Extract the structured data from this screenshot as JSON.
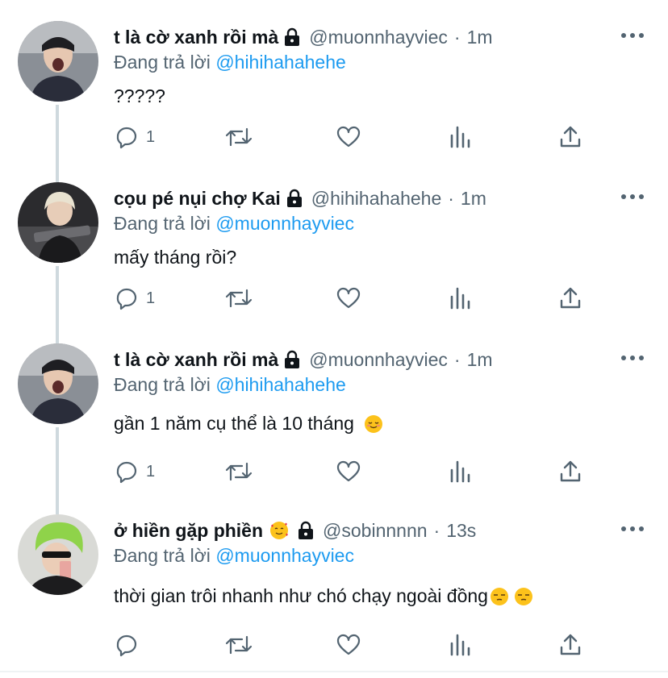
{
  "tweets": [
    {
      "name": "t là cờ xanh rồi mà",
      "handle": "@muonnhayviec",
      "dot": "·",
      "time": "1m",
      "reply_prefix": "Đang trả lời",
      "reply_to": "@hihihahahehe",
      "text": "?????",
      "reply_count": "1",
      "avatar": "avatar-photo-boy"
    },
    {
      "name": "cọu pé nụi chợ Kai",
      "handle": "@hihihahahehe",
      "dot": "·",
      "time": "1m",
      "reply_prefix": "Đang trả lời",
      "reply_to": "@muonnhayviec",
      "text": "mấy tháng rồi?",
      "reply_count": "1",
      "avatar": "avatar-photo-blond"
    },
    {
      "name": "t là cờ xanh rồi mà",
      "handle": "@muonnhayviec",
      "dot": "·",
      "time": "1m",
      "reply_prefix": "Đang trả lời",
      "reply_to": "@hihihahahehe",
      "text": "gần 1 năm cụ thể là 10 tháng",
      "text_emoji": "relieved-face-emoji",
      "reply_count": "1",
      "avatar": "avatar-photo-boy"
    },
    {
      "name": "ở hiền gặp phiền",
      "name_emoji": "smiling-face-with-hearts-emoji",
      "handle": "@sobinnnnn",
      "dot": "·",
      "time": "13s",
      "reply_prefix": "Đang trả lời",
      "reply_to": "@muonnhayviec",
      "text": "thời gian trôi nhanh như chó chạy ngoài đồng",
      "text_emoji": "unamused-face-emoji",
      "reply_count": "",
      "avatar": "avatar-photo-greenhat"
    }
  ],
  "colors": {
    "link": "#1d9bf0",
    "secondary_text": "#536471",
    "primary_text": "#0f1419",
    "thread_line": "#cfd9de"
  },
  "icons": {
    "reply": "reply-icon",
    "retweet": "retweet-icon",
    "like": "like-icon",
    "analytics": "analytics-icon",
    "share": "share-icon",
    "lock": "lock-icon",
    "more": "more-icon"
  }
}
